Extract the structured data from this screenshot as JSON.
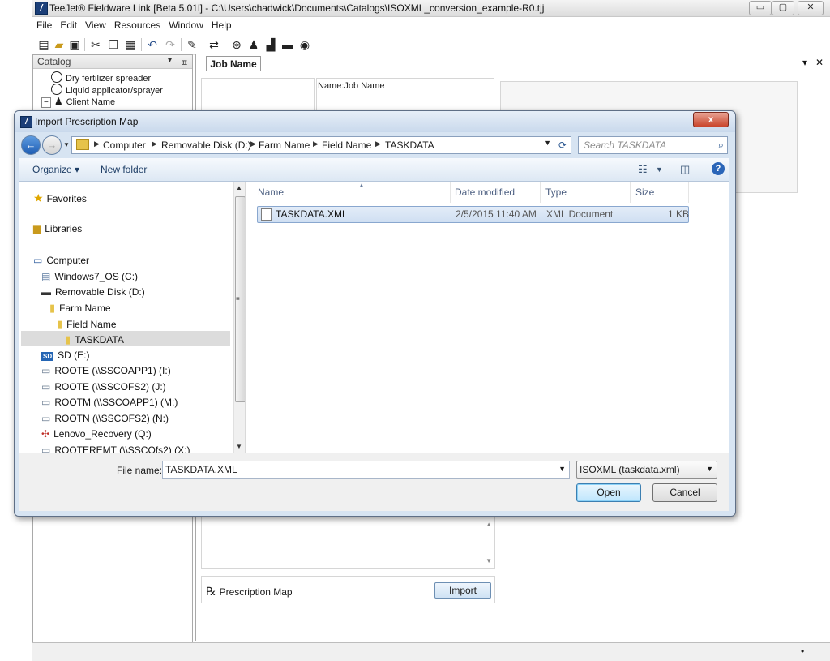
{
  "app": {
    "title": "TeeJet® Fieldware Link [Beta 5.01l] - C:\\Users\\chadwick\\Documents\\Catalogs\\ISOXML_conversion_example-R0.tjj",
    "menu": [
      "File",
      "Edit",
      "View",
      "Resources",
      "Window",
      "Help"
    ],
    "window_controls": {
      "minimize": "▭",
      "maximize": "▢",
      "close": "✕"
    }
  },
  "catalog": {
    "title": "Catalog",
    "items": [
      {
        "label": "Dry fertilizer spreader",
        "icon": "gear-wheel-icon"
      },
      {
        "label": "Liquid applicator/sprayer",
        "icon": "gear-wheel-icon"
      },
      {
        "label": "Client Name",
        "icon": "person-icon"
      }
    ]
  },
  "document": {
    "tab_label": "Job Name",
    "job_name_label": "Name:Job Name",
    "prescription_label": "Prescription Map",
    "import_button": "Import",
    "rx_symbol": "℞"
  },
  "dialog": {
    "title": "Import Prescription Map",
    "close_label": "x",
    "breadcrumbs": [
      "Computer",
      "Removable Disk (D:)",
      "Farm Name",
      "Field Name",
      "TASKDATA"
    ],
    "search_placeholder": "Search TASKDATA",
    "toolbar": {
      "organize": "Organize ▾",
      "new_folder": "New folder"
    },
    "nav_items": [
      {
        "label": "Favorites",
        "icon": "star-icon"
      },
      {
        "label": "Libraries",
        "icon": "library-icon"
      },
      {
        "label": "Computer",
        "icon": "computer-icon"
      },
      {
        "label": "Windows7_OS (C:)",
        "icon": "hard-drive-icon"
      },
      {
        "label": "Removable Disk (D:)",
        "icon": "removable-disk-icon"
      },
      {
        "label": "Farm Name",
        "icon": "folder-icon"
      },
      {
        "label": "Field Name",
        "icon": "folder-icon"
      },
      {
        "label": "TASKDATA",
        "icon": "folder-icon",
        "selected": true
      },
      {
        "label": "SD (E:)",
        "icon": "sd-card-icon"
      },
      {
        "label": "ROOTE (\\\\SSCOAPP1) (I:)",
        "icon": "network-drive-icon"
      },
      {
        "label": "ROOTE (\\\\SSCOFS2) (J:)",
        "icon": "network-drive-icon"
      },
      {
        "label": "ROOTM (\\\\SSCOAPP1) (M:)",
        "icon": "network-drive-icon"
      },
      {
        "label": "ROOTN (\\\\SSCOFS2) (N:)",
        "icon": "network-drive-icon"
      },
      {
        "label": "Lenovo_Recovery (Q:)",
        "icon": "recovery-drive-icon"
      },
      {
        "label": "ROOTEREMT (\\\\SSCOfs2) (X:)",
        "icon": "network-drive-icon"
      }
    ],
    "columns": [
      "Name",
      "Date modified",
      "Type",
      "Size"
    ],
    "files": [
      {
        "name": "TASKDATA.XML",
        "date_modified": "2/5/2015 11:40 AM",
        "type": "XML Document",
        "size": "1 KB"
      }
    ],
    "file_name_label": "File name:",
    "file_name_value": "TASKDATA.XML",
    "file_type": "ISOXML (taskdata.xml)",
    "open_button": "Open",
    "cancel_button": "Cancel"
  },
  "colors": {
    "dialog_frame": "#d7e4f2",
    "selected_file_row": "#cfdff2",
    "close_button": "#c9442b",
    "folder": "#e6c34a"
  }
}
